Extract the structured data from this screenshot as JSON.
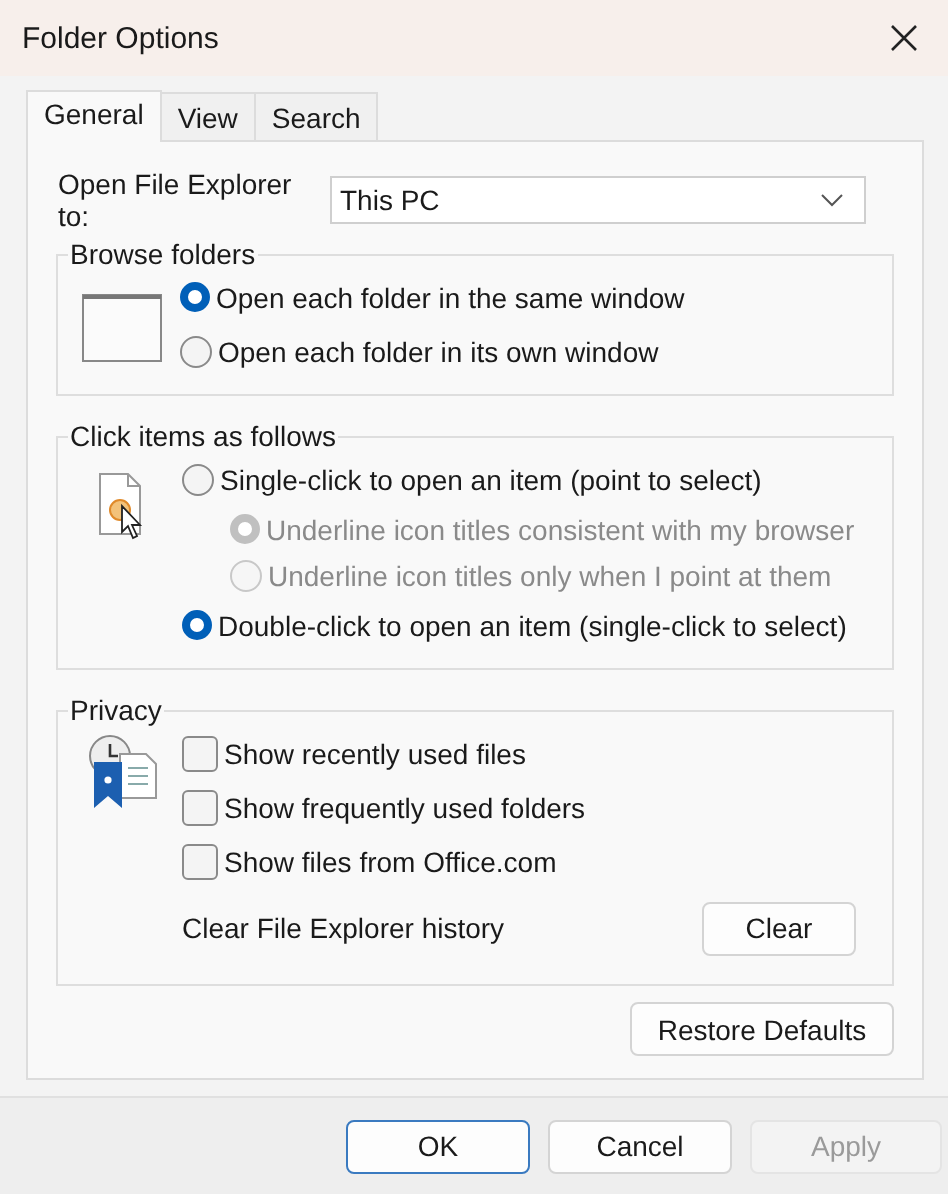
{
  "window": {
    "title": "Folder Options"
  },
  "tabs": [
    {
      "label": "General",
      "selected": true
    },
    {
      "label": "View",
      "selected": false
    },
    {
      "label": "Search",
      "selected": false
    }
  ],
  "open_to": {
    "label": "Open File Explorer to:",
    "value": "This PC"
  },
  "browse_folders": {
    "title": "Browse folders",
    "options": [
      {
        "label": "Open each folder in the same window",
        "selected": true
      },
      {
        "label": "Open each folder in its own window",
        "selected": false
      }
    ]
  },
  "click_items": {
    "title": "Click items as follows",
    "options": [
      {
        "label": "Single-click to open an item (point to select)",
        "selected": false,
        "disabled": false,
        "children": [
          {
            "label": "Underline icon titles consistent with my browser",
            "selected": true,
            "disabled": true
          },
          {
            "label": "Underline icon titles only when I point at them",
            "selected": false,
            "disabled": true
          }
        ]
      },
      {
        "label": "Double-click to open an item (single-click to select)",
        "selected": true,
        "disabled": false
      }
    ]
  },
  "privacy": {
    "title": "Privacy",
    "options": [
      {
        "label": "Show recently used files",
        "checked": false
      },
      {
        "label": "Show frequently used folders",
        "checked": false
      },
      {
        "label": "Show files from Office.com",
        "checked": false
      }
    ],
    "clear_label": "Clear File Explorer history",
    "clear_button": "Clear"
  },
  "restore_button": "Restore Defaults",
  "buttons": [
    {
      "label": "OK",
      "default": true,
      "disabled": false
    },
    {
      "label": "Cancel",
      "default": false,
      "disabled": false
    },
    {
      "label": "Apply",
      "default": false,
      "disabled": true
    }
  ]
}
